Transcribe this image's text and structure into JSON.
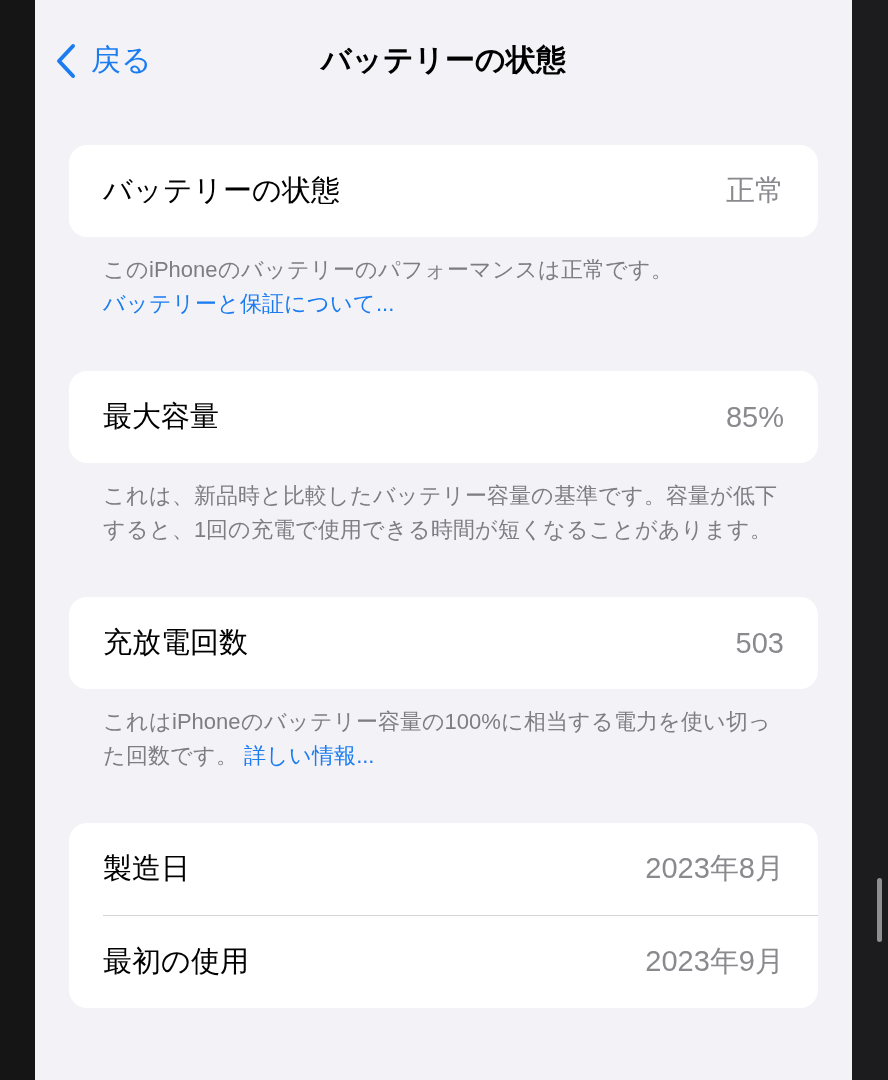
{
  "nav": {
    "back": "戻る",
    "title": "バッテリーの状態"
  },
  "sections": [
    {
      "rows": [
        {
          "label": "バッテリーの状態",
          "value": "正常"
        }
      ],
      "footer": {
        "text": "このiPhoneのバッテリーのパフォーマンスは正常です。",
        "link_line": "バッテリーと保証について..."
      }
    },
    {
      "rows": [
        {
          "label": "最大容量",
          "value": "85%"
        }
      ],
      "footer": {
        "text": "これは、新品時と比較したバッテリー容量の基準です。容量が低下すると、1回の充電で使用できる時間が短くなることがあります。"
      }
    },
    {
      "rows": [
        {
          "label": "充放電回数",
          "value": "503"
        }
      ],
      "footer": {
        "text": "これはiPhoneのバッテリー容量の100%に相当する電力を使い切った回数です。",
        "link": "詳しい情報..."
      }
    },
    {
      "rows": [
        {
          "label": "製造日",
          "value": "2023年8月"
        },
        {
          "label": "最初の使用",
          "value": "2023年9月"
        }
      ]
    }
  ]
}
